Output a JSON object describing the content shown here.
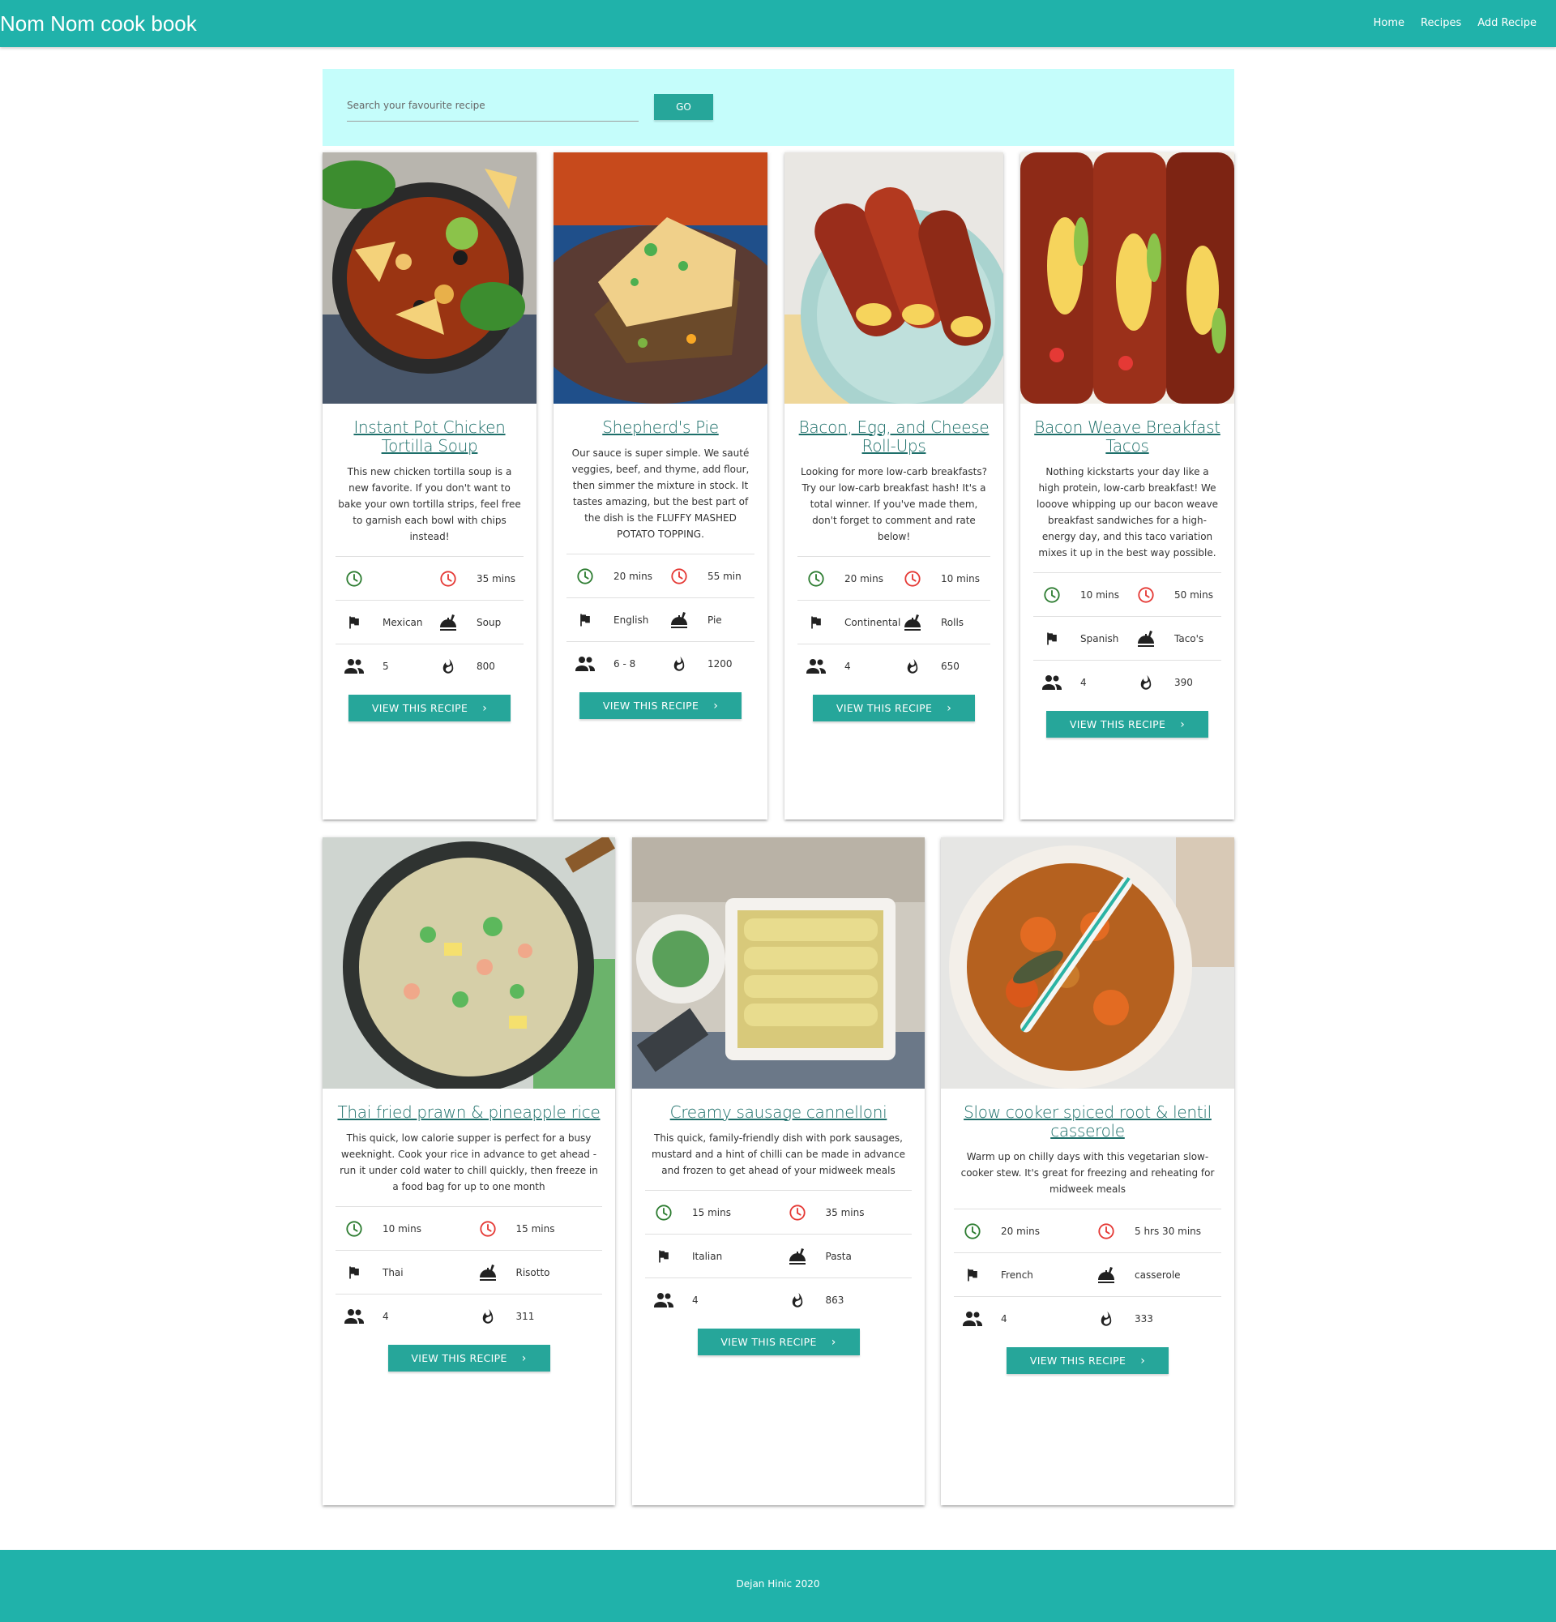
{
  "nav": {
    "brand": "Nom Nom cook book",
    "links": [
      "Home",
      "Recipes",
      "Add Recipe"
    ]
  },
  "search": {
    "placeholder": "Search your favourite recipe",
    "button": "GO"
  },
  "button_label": "VIEW THIS RECIPE",
  "recipes": [
    {
      "title": "Instant Pot Chicken Tortilla Soup",
      "desc": "This new chicken tortilla soup is a new favorite. If you don't want to bake your own tortilla strips, feel free to garnish each bowl with chips instead!",
      "prep": "",
      "cook": "35 mins",
      "cuisine": "Mexican",
      "category": "Soup",
      "serves": "5",
      "calories": "800"
    },
    {
      "title": "Shepherd's Pie",
      "desc": "Our sauce is super simple. We sauté veggies, beef, and thyme, add flour, then simmer the mixture in stock. It tastes amazing, but the best part of the dish is the FLUFFY MASHED POTATO TOPPING.",
      "prep": "20 mins",
      "cook": "55 min",
      "cuisine": "English",
      "category": "Pie",
      "serves": "6 - 8",
      "calories": "1200"
    },
    {
      "title": "Bacon, Egg, and Cheese Roll-Ups",
      "desc": "Looking for more low-carb breakfasts? Try our low-carb breakfast hash! It's a total winner. If you've made them, don't forget to comment and rate below!",
      "prep": "20 mins",
      "cook": "10 mins",
      "cuisine": "Continental",
      "category": "Rolls",
      "serves": "4",
      "calories": "650"
    },
    {
      "title": "Bacon Weave Breakfast Tacos",
      "desc": "Nothing kickstarts your day like a high protein, low-carb breakfast! We looove whipping up our bacon weave breakfast sandwiches for a high-energy day, and this taco variation mixes it up in the best way possible.",
      "prep": "10 mins",
      "cook": "50 mins",
      "cuisine": "Spanish",
      "category": "Taco's",
      "serves": "4",
      "calories": "390"
    },
    {
      "title": "Thai fried prawn & pineapple rice",
      "desc": "This quick, low calorie supper is perfect for a busy weeknight. Cook your rice in advance to get ahead - run it under cold water to chill quickly, then freeze in a food bag for up to one month",
      "prep": "10 mins",
      "cook": "15 mins",
      "cuisine": "Thai",
      "category": "Risotto",
      "serves": "4",
      "calories": "311"
    },
    {
      "title": "Creamy sausage cannelloni",
      "desc": "This quick, family-friendly dish with pork sausages, mustard and a hint of chilli can be made in advance and frozen to get ahead of your midweek meals",
      "prep": "15 mins",
      "cook": "35 mins",
      "cuisine": "Italian",
      "category": "Pasta",
      "serves": "4",
      "calories": "863"
    },
    {
      "title": "Slow cooker spiced root & lentil casserole",
      "desc": "Warm up on chilly days with this vegetarian slow-cooker stew. It's great for freezing and reheating for midweek meals",
      "prep": "20 mins",
      "cook": "5 hrs 30 mins",
      "cuisine": "French",
      "category": "casserole",
      "serves": "4",
      "calories": "333"
    }
  ],
  "footer": {
    "text": "Dejan Hinic 2020"
  },
  "colors": {
    "primary": "#20b2aa",
    "button": "#26a69a",
    "search_bg": "#c5fdfb",
    "prep_clock": "#2e7d32",
    "cook_clock": "#e53935",
    "title_link": "#1d6f6a"
  }
}
